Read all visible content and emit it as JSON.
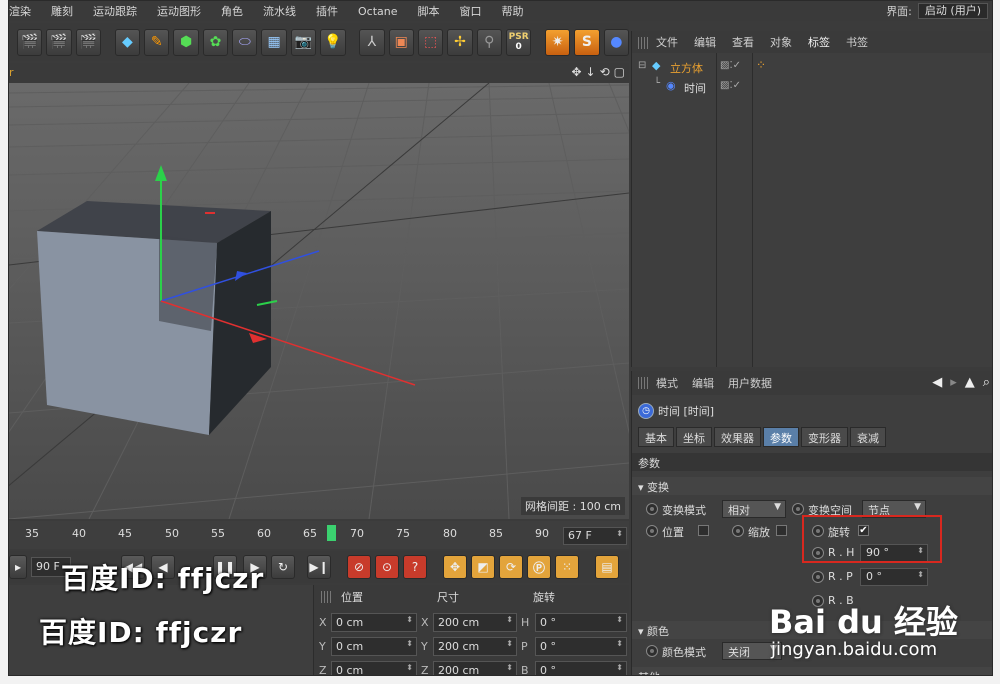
{
  "menubar": {
    "items": [
      "渲染",
      "雕刻",
      "运动跟踪",
      "运动图形",
      "角色",
      "流水线",
      "插件",
      "Octane",
      "脚本",
      "窗口",
      "帮助"
    ],
    "layout_label": "界面:",
    "layout_value": "启动 (用户)"
  },
  "toolbar": {
    "psr_label": "PSR",
    "psr_value": "0"
  },
  "viewport": {
    "name": "r",
    "grid_spacing": "网格间距 : 100 cm"
  },
  "timeline": {
    "ticks": [
      "35",
      "40",
      "45",
      "50",
      "55",
      "60",
      "65",
      "70",
      "75",
      "80",
      "85",
      "90"
    ],
    "end_frame": "67 F",
    "current_frame": "90 F"
  },
  "coords": {
    "headers": {
      "position": "位置",
      "size": "尺寸",
      "rotation": "旋转"
    },
    "rows": [
      {
        "axis": "X",
        "pos": "0 cm",
        "size_axis": "X",
        "size": "200 cm",
        "rot_axis": "H",
        "rot": "0 °"
      },
      {
        "axis": "Y",
        "pos": "0 cm",
        "size_axis": "Y",
        "size": "200 cm",
        "rot_axis": "P",
        "rot": "0 °"
      },
      {
        "axis": "Z",
        "pos": "0 cm",
        "size_axis": "Z",
        "size": "200 cm",
        "rot_axis": "B",
        "rot": "0 °"
      }
    ]
  },
  "object_manager": {
    "tabs": [
      "文件",
      "编辑",
      "查看",
      "对象",
      "标签",
      "书签"
    ],
    "objects": [
      {
        "name": "立方体",
        "color": "#e8a030"
      },
      {
        "name": "时间",
        "color": "#dddddd"
      }
    ]
  },
  "attribute_manager": {
    "tabs": [
      "模式",
      "编辑",
      "用户数据"
    ],
    "object_title": "时间 [时间]",
    "attr_tabs": [
      "基本",
      "坐标",
      "效果器",
      "参数",
      "变形器",
      "衰减"
    ],
    "active_attr_tab": "参数",
    "section_params": "参数",
    "section_transform": "▾ 变换",
    "transform_mode_label": "变换模式",
    "transform_mode_value": "相对",
    "transform_space_label": "变换空间",
    "transform_space_value": "节点",
    "position_label": "位置",
    "scale_label": "缩放",
    "rotation_label": "旋转",
    "rotation_checked": "✔",
    "rh_label": "R . H",
    "rh_value": "90 °",
    "rp_label": "R . P",
    "rp_value": "0 °",
    "rb_label": "R . B",
    "section_color": "▾ 颜色",
    "color_mode_label": "颜色模式",
    "color_mode_value": "关闭",
    "section_other": "其他"
  },
  "watermark": {
    "text1": "百度ID: ffjczr",
    "text2": "百度ID: ffjczr",
    "baidu_brand": "Bai  du 经验",
    "baidu_url": "jingyan.baidu.com"
  },
  "colors": {
    "accent_blue": "#5a7fa8",
    "highlight_red": "#d8281f",
    "playhead_green": "#3bd16f"
  }
}
